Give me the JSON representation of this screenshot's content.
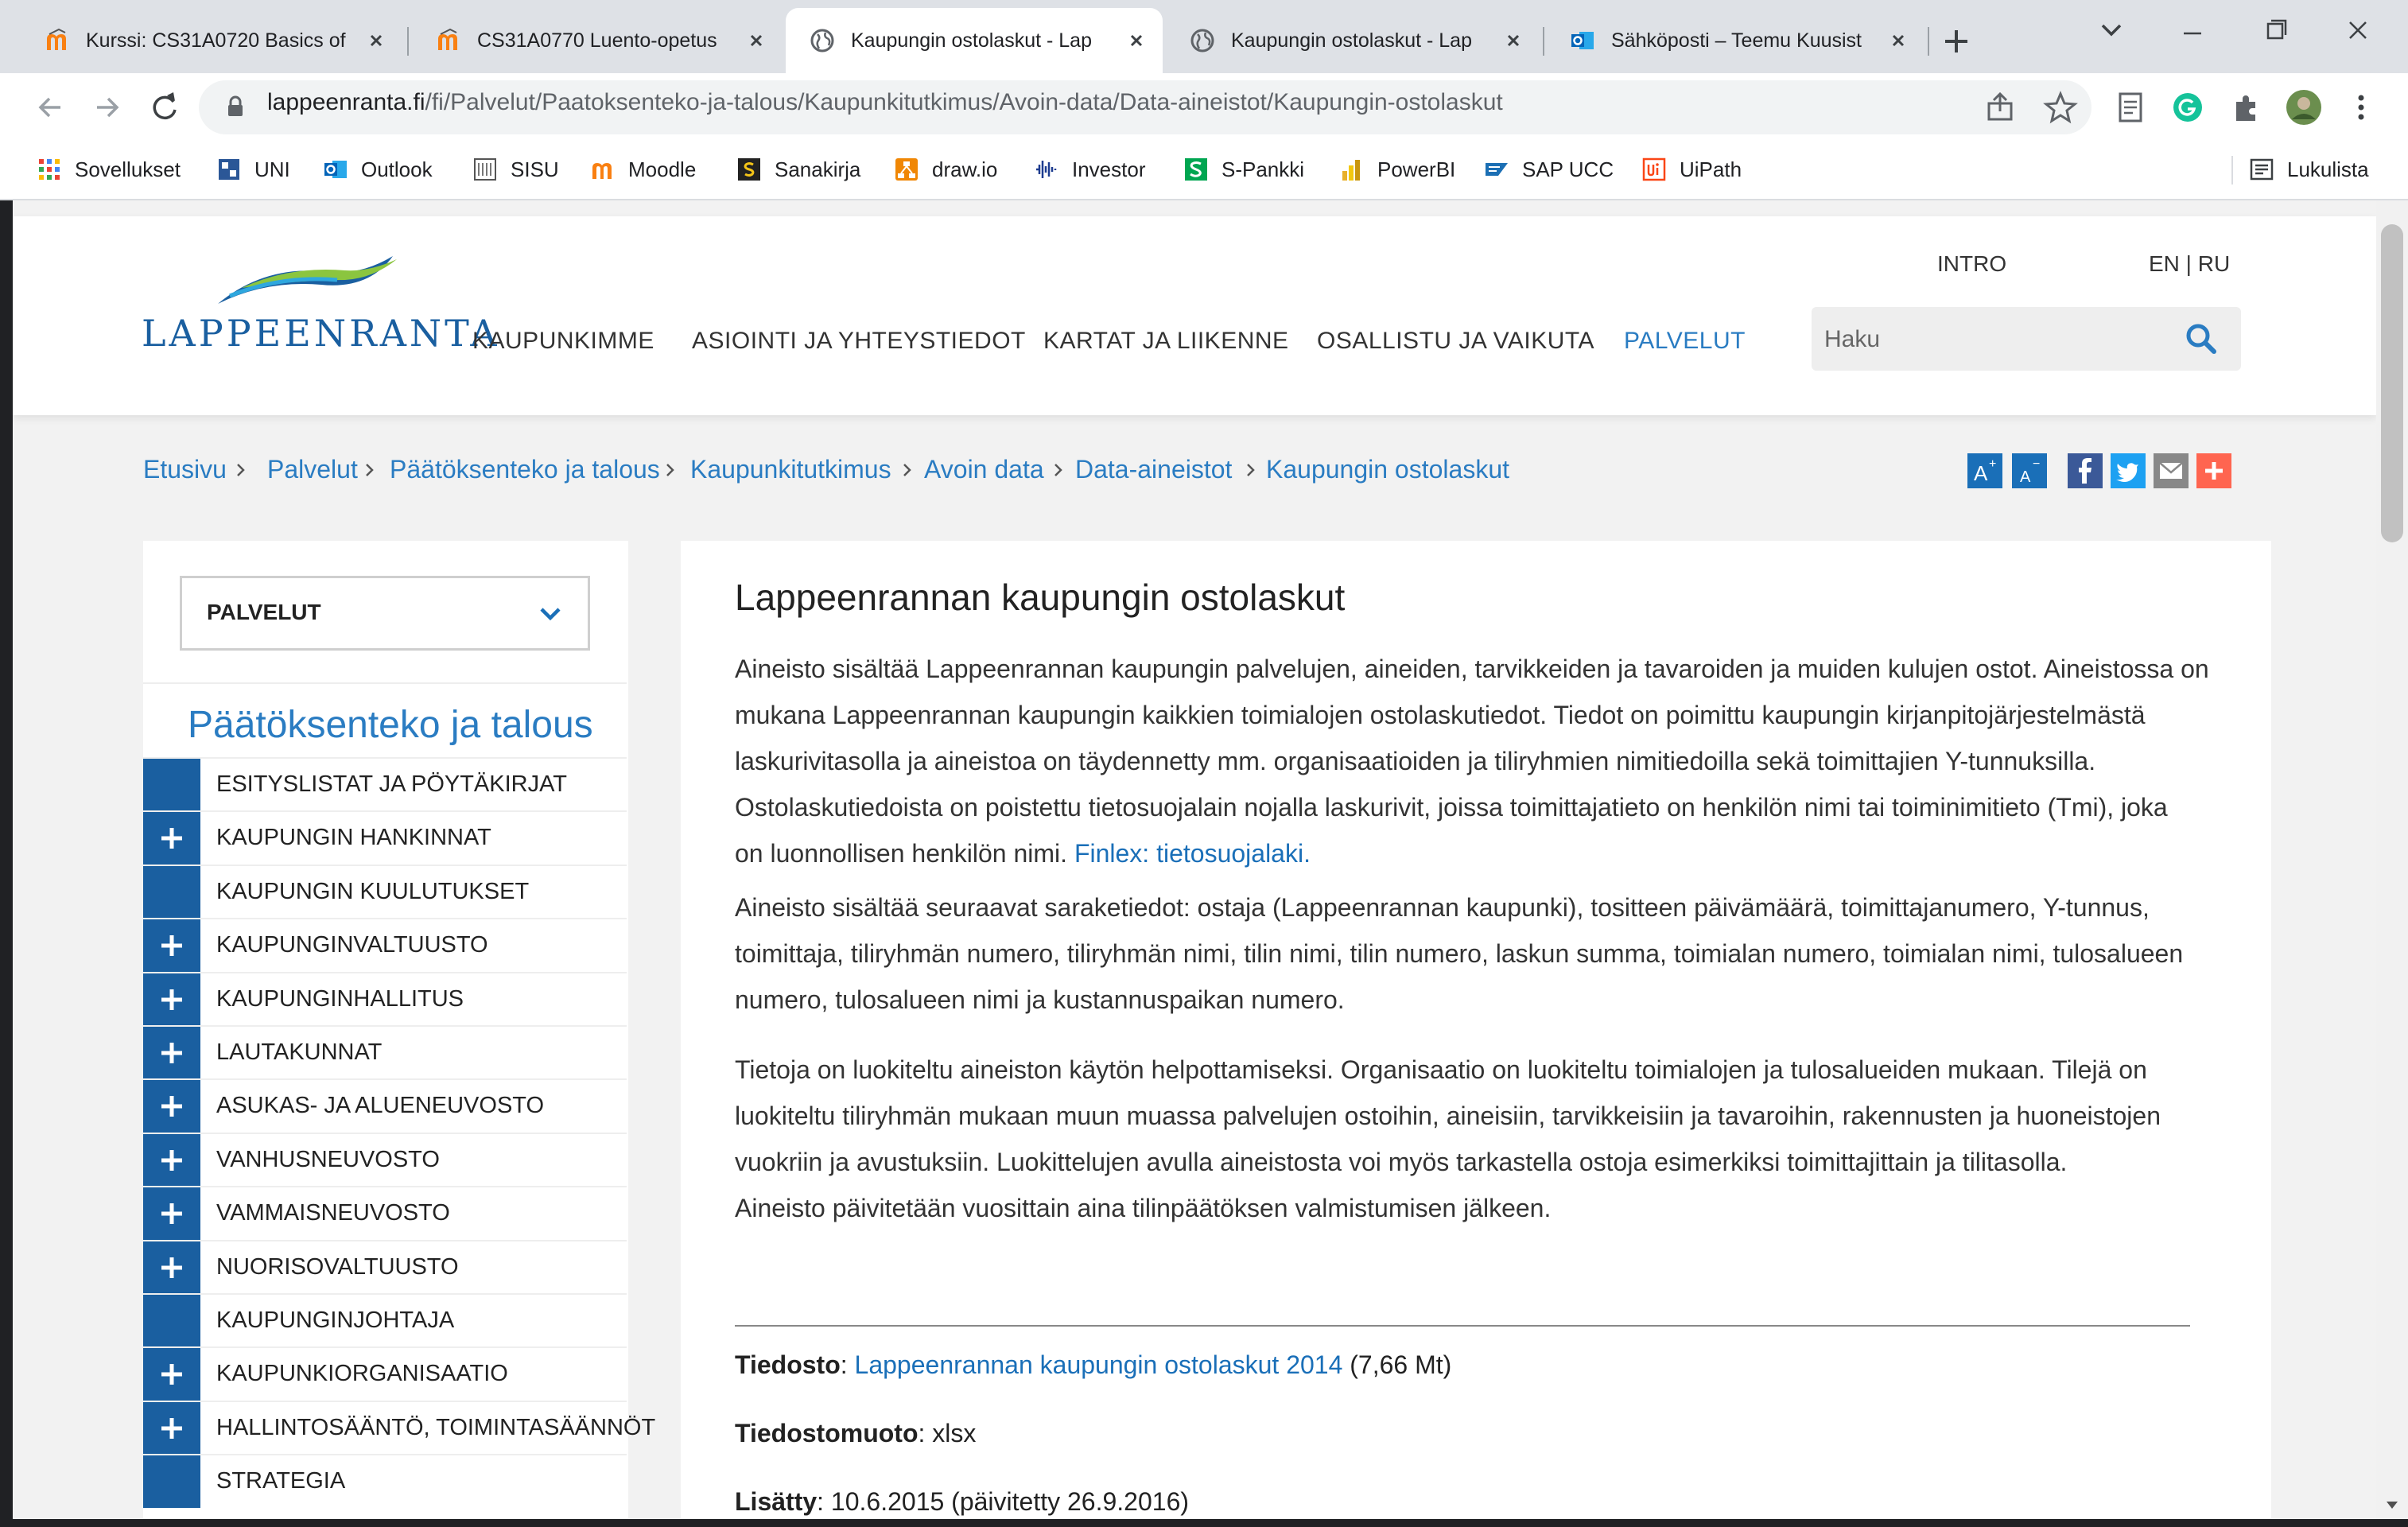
{
  "browser": {
    "tabs": [
      {
        "title": "Kurssi: CS31A0720 Basics of",
        "favicon": "moodle-icon",
        "active": false
      },
      {
        "title": "CS31A0770 Luento-opetus",
        "favicon": "moodle-icon",
        "active": false
      },
      {
        "title": "Kaupungin ostolaskut - Lap",
        "favicon": "globe-icon",
        "active": true
      },
      {
        "title": "Kaupungin ostolaskut - Lap",
        "favicon": "globe-icon",
        "active": false
      },
      {
        "title": "Sähköposti – Teemu Kuusist",
        "favicon": "outlook-icon",
        "active": false
      }
    ],
    "url_domain": "lappeenranta.fi",
    "url_path": "/fi/Palvelut/Paatoksenteko-ja-talous/Kaupunkitutkimus/Avoin-data/Data-aineistot/Kaupungin-ostolaskut",
    "bookmarks": [
      {
        "label": "Sovellukset",
        "icon": "apps-grid-icon"
      },
      {
        "label": "UNI",
        "icon": "uni-icon"
      },
      {
        "label": "Outlook",
        "icon": "outlook-icon"
      },
      {
        "label": "SISU",
        "icon": "sisu-icon"
      },
      {
        "label": "Moodle",
        "icon": "moodle-icon"
      },
      {
        "label": "Sanakirja",
        "icon": "sanakirja-icon"
      },
      {
        "label": "draw.io",
        "icon": "drawio-icon"
      },
      {
        "label": "Investor",
        "icon": "investor-icon"
      },
      {
        "label": "S-Pankki",
        "icon": "spankki-icon"
      },
      {
        "label": "PowerBI",
        "icon": "powerbi-icon"
      },
      {
        "label": "SAP UCC",
        "icon": "sap-icon"
      },
      {
        "label": "UiPath",
        "icon": "uipath-icon"
      }
    ],
    "reading_list": "Lukulista"
  },
  "site": {
    "logo": "LAPPEENRANTA",
    "nav": [
      "KAUPUNKIMME",
      "ASIOINTI JA YHTEYSTIEDOT",
      "KARTAT JA LIIKENNE",
      "OSALLISTU JA VAIKUTA",
      "PALVELUT"
    ],
    "active_nav": "PALVELUT",
    "intro_link": "INTRO",
    "lang_links": "EN | RU",
    "search_placeholder": "Haku",
    "accent_color": "#2a7cc2",
    "brand_color": "#1a5fa0"
  },
  "breadcrumb": [
    "Etusivu",
    "Palvelut",
    "Päätöksenteko ja talous",
    "Kaupunkitutkimus",
    "Avoin data",
    "Data-aineistot",
    "Kaupungin ostolaskut"
  ],
  "share_icons": [
    "font-increase-icon",
    "font-decrease-icon",
    "facebook-icon",
    "twitter-icon",
    "email-icon",
    "addthis-plus-icon"
  ],
  "sidebar": {
    "select_label": "PALVELUT",
    "title": "Päätöksenteko ja talous",
    "items": [
      {
        "label": "ESITYSLISTAT JA PÖYTÄKIRJAT",
        "expandable": false
      },
      {
        "label": "KAUPUNGIN HANKINNAT",
        "expandable": true
      },
      {
        "label": "KAUPUNGIN KUULUTUKSET",
        "expandable": false
      },
      {
        "label": "KAUPUNGINVALTUUSTO",
        "expandable": true
      },
      {
        "label": "KAUPUNGINHALLITUS",
        "expandable": true
      },
      {
        "label": "LAUTAKUNNAT",
        "expandable": true
      },
      {
        "label": "ASUKAS- JA ALUENEUVOSTO",
        "expandable": true
      },
      {
        "label": "VANHUSNEUVOSTO",
        "expandable": true
      },
      {
        "label": "VAMMAISNEUVOSTO",
        "expandable": true
      },
      {
        "label": "NUORISOVALTUUSTO",
        "expandable": true
      },
      {
        "label": "KAUPUNGINJOHTAJA",
        "expandable": false
      },
      {
        "label": "KAUPUNKIORGANISAATIO",
        "expandable": true
      },
      {
        "label": "HALLINTOSÄÄNTÖ, TOIMINTASÄÄNNÖT",
        "expandable": true
      },
      {
        "label": "STRATEGIA",
        "expandable": false
      }
    ]
  },
  "article": {
    "title": "Lappeenrannan kaupungin ostolaskut",
    "p1_lines": [
      "Aineisto sisältää Lappeenrannan kaupungin palvelujen, aineiden, tarvikkeiden ja tavaroiden ja muiden kulujen ostot. Aineistossa on",
      "mukana Lappeenrannan kaupungin kaikkien toimialojen ostolaskutiedot. Tiedot on poimittu kaupungin kirjanpitojärjestelmästä",
      "laskurivitasolla ja aineistoa on täydennetty mm. organisaatioiden ja tiliryhmien nimitiedoilla sekä toimittajien Y-tunnuksilla.",
      "Ostolaskutiedoista on poistettu tietosuojalain nojalla laskurivit, joissa toimittajatieto on henkilön nimi tai toiminimitieto (Tmi), joka",
      "on luonnollisen henkilön nimi."
    ],
    "p1_link": "Finlex: tietosuojalaki.",
    "p2_lines": [
      "Aineisto sisältää seuraavat saraketiedot: ostaja (Lappeenrannan kaupunki), tositteen päivämäärä, toimittajanumero, Y-tunnus,",
      "toimittaja, tiliryhmän numero, tiliryhmän nimi, tilin nimi, tilin numero, laskun summa, toimialan numero, toimialan nimi, tulosalueen",
      "numero, tulosalueen nimi ja kustannuspaikan numero."
    ],
    "p3_lines": [
      "Tietoja on luokiteltu aineiston käytön helpottamiseksi. Organisaatio on luokiteltu toimialojen ja tulosalueiden mukaan. Tilejä on",
      "luokiteltu tiliryhmän mukaan muun muassa palvelujen ostoihin, aineisiin, tarvikkeisiin ja tavaroihin, rakennusten ja huoneistojen",
      "vuokriin ja avustuksiin. Luokittelujen avulla aineistosta voi myös tarkastella ostoja esimerkiksi toimittajittain ja tilitasolla.",
      "Aineisto päivitetään vuosittain aina tilinpäätöksen valmistumisen jälkeen."
    ],
    "file_label": "Tiedosto",
    "file_link": "Lappeenrannan kaupungin ostolaskut 2014",
    "file_size": "(7,66 Mt)",
    "format_label": "Tiedostomuoto",
    "format_value": "xlsx",
    "added_label": "Lisätty",
    "added_value": "10.6.2015 (päivitetty 26.9.2016)"
  }
}
